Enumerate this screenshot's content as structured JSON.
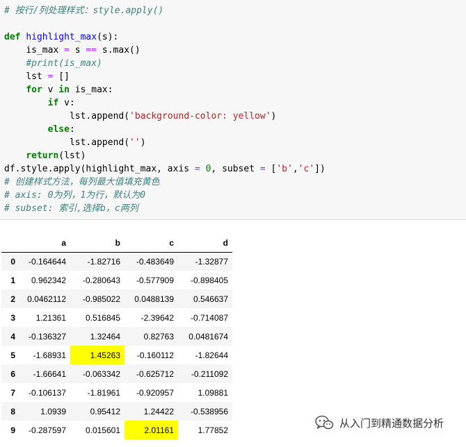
{
  "code_lines": [
    {
      "indent": 0,
      "segments": [
        {
          "t": "# 按行/列处理样式：style.apply()",
          "c": "c"
        }
      ]
    },
    {
      "indent": 0,
      "segments": []
    },
    {
      "indent": 0,
      "segments": [
        {
          "t": "def",
          "c": "k"
        },
        {
          "t": " "
        },
        {
          "t": "highlight_max",
          "c": "nf"
        },
        {
          "t": "(s):"
        }
      ]
    },
    {
      "indent": 4,
      "segments": [
        {
          "t": "is_max "
        },
        {
          "t": "=",
          "c": "o"
        },
        {
          "t": " s "
        },
        {
          "t": "==",
          "c": "o"
        },
        {
          "t": " s.max()"
        }
      ]
    },
    {
      "indent": 4,
      "segments": [
        {
          "t": "#print(is_max)",
          "c": "c"
        }
      ]
    },
    {
      "indent": 4,
      "segments": [
        {
          "t": "lst "
        },
        {
          "t": "=",
          "c": "o"
        },
        {
          "t": " []"
        }
      ]
    },
    {
      "indent": 4,
      "segments": [
        {
          "t": "for",
          "c": "k"
        },
        {
          "t": " v "
        },
        {
          "t": "in",
          "c": "k"
        },
        {
          "t": " is_max:"
        }
      ]
    },
    {
      "indent": 8,
      "segments": [
        {
          "t": "if",
          "c": "k"
        },
        {
          "t": " v:"
        }
      ]
    },
    {
      "indent": 12,
      "segments": [
        {
          "t": "lst.append("
        },
        {
          "t": "'background-color: yellow'",
          "c": "s"
        },
        {
          "t": ")"
        }
      ]
    },
    {
      "indent": 8,
      "segments": [
        {
          "t": "else",
          "c": "k"
        },
        {
          "t": ":"
        }
      ]
    },
    {
      "indent": 12,
      "segments": [
        {
          "t": "lst.append("
        },
        {
          "t": "''",
          "c": "s"
        },
        {
          "t": ")"
        }
      ]
    },
    {
      "indent": 4,
      "segments": [
        {
          "t": "return",
          "c": "k"
        },
        {
          "t": "(lst)"
        }
      ]
    },
    {
      "indent": 0,
      "segments": [
        {
          "t": "df.style.apply(highlight_max, axis "
        },
        {
          "t": "=",
          "c": "o"
        },
        {
          "t": " "
        },
        {
          "t": "0",
          "c": "mi"
        },
        {
          "t": ", subset "
        },
        {
          "t": "=",
          "c": "o"
        },
        {
          "t": " ["
        },
        {
          "t": "'b'",
          "c": "s"
        },
        {
          "t": ","
        },
        {
          "t": "'c'",
          "c": "s"
        },
        {
          "t": "])"
        }
      ]
    },
    {
      "indent": 0,
      "segments": [
        {
          "t": "# 创建样式方法，每列最大值填充黄色",
          "c": "c"
        }
      ]
    },
    {
      "indent": 0,
      "segments": [
        {
          "t": "# axis: 0为列，1为行，默认为0",
          "c": "c"
        }
      ]
    },
    {
      "indent": 0,
      "segments": [
        {
          "t": "# subset: 索引,选择b，c两列",
          "c": "c"
        }
      ]
    }
  ],
  "table": {
    "columns": [
      "",
      "a",
      "b",
      "c",
      "d"
    ],
    "rows": [
      {
        "index": "0",
        "cells": [
          "-0.164644",
          "-1.82716",
          "-0.483649",
          "-1.32877"
        ]
      },
      {
        "index": "1",
        "cells": [
          "0.962342",
          "-0.280643",
          "-0.577909",
          "-0.898405"
        ]
      },
      {
        "index": "2",
        "cells": [
          "0.0462112",
          "-0.985022",
          "0.0488139",
          "0.546637"
        ]
      },
      {
        "index": "3",
        "cells": [
          "1.21361",
          "0.516845",
          "-2.39642",
          "-0.714087"
        ]
      },
      {
        "index": "4",
        "cells": [
          "-0.136327",
          "1.32464",
          "0.82763",
          "0.0481674"
        ]
      },
      {
        "index": "5",
        "cells": [
          "-1.68931",
          "1.45263",
          "-0.160112",
          "-1.82644"
        ]
      },
      {
        "index": "6",
        "cells": [
          "-1.66641",
          "-0.063342",
          "-0.625712",
          "-0.211092"
        ]
      },
      {
        "index": "7",
        "cells": [
          "-0.106137",
          "-1.81961",
          "-0.920957",
          "1.09881"
        ]
      },
      {
        "index": "8",
        "cells": [
          "1.0939",
          "0.95412",
          "1.24422",
          "-0.538956"
        ]
      },
      {
        "index": "9",
        "cells": [
          "-0.287597",
          "0.015601",
          "2.01161",
          "1.77852"
        ]
      }
    ],
    "highlighted": [
      {
        "row": 5,
        "col": 1
      },
      {
        "row": 9,
        "col": 2
      }
    ],
    "highlight_color": "#ffff00"
  },
  "watermark": {
    "icon": "wechat-icon",
    "text": "从入门到精通数据分析"
  }
}
